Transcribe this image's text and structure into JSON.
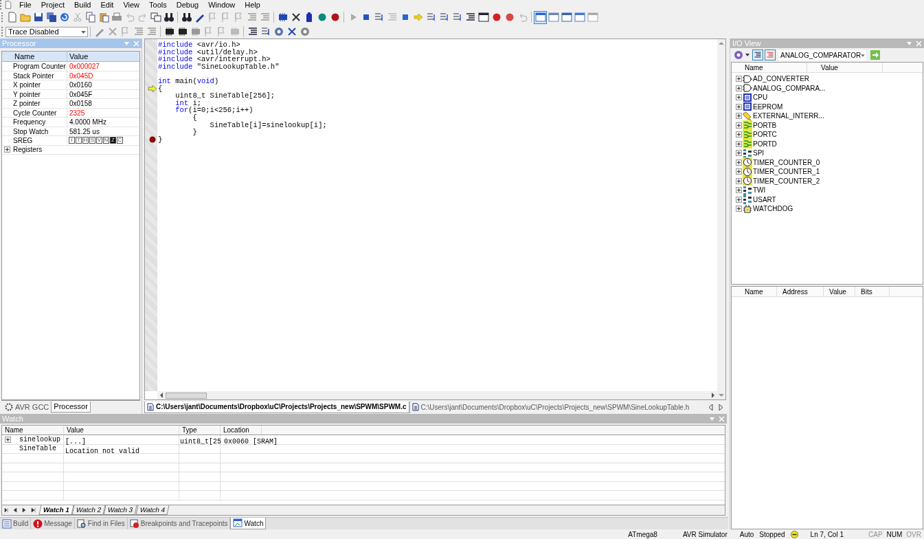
{
  "menu": [
    "File",
    "Project",
    "Build",
    "Edit",
    "View",
    "Tools",
    "Debug",
    "Window",
    "Help"
  ],
  "toolbar": {
    "trace_combo": "Trace Disabled"
  },
  "processor_panel": {
    "title": "Processor",
    "columns": [
      "Name",
      "Value"
    ],
    "rows": [
      {
        "name": "Program Counter",
        "value": "0x000027",
        "changed": true
      },
      {
        "name": "Stack Pointer",
        "value": "0x045D",
        "changed": true
      },
      {
        "name": "X pointer",
        "value": "0x0160",
        "changed": false
      },
      {
        "name": "Y pointer",
        "value": "0x045F",
        "changed": false
      },
      {
        "name": "Z pointer",
        "value": "0x0158",
        "changed": false
      },
      {
        "name": "Cycle Counter",
        "value": "2325",
        "changed": true
      },
      {
        "name": "Frequency",
        "value": "4.0000 MHz",
        "changed": false
      },
      {
        "name": "Stop Watch",
        "value": "581.25 us",
        "changed": false
      }
    ],
    "sreg": {
      "name": "SREG",
      "flags": [
        {
          "label": "I",
          "set": false
        },
        {
          "label": "T",
          "set": false
        },
        {
          "label": "H",
          "set": false
        },
        {
          "label": "S",
          "set": false
        },
        {
          "label": "V",
          "set": false
        },
        {
          "label": "N",
          "set": false
        },
        {
          "label": "Z",
          "set": true
        },
        {
          "label": "C",
          "set": false
        }
      ]
    },
    "registers": {
      "name": "Registers",
      "expanded": false
    },
    "tabs": [
      {
        "label": "AVR GCC",
        "selected": false
      },
      {
        "label": "Processor",
        "selected": true
      }
    ]
  },
  "editor": {
    "blocks": [
      {
        "lines": [
          {
            "current": false,
            "breakpoint": false,
            "tokens": [
              {
                "kind": "keyword",
                "text": "#include"
              },
              {
                "kind": "plain",
                "text": " <avr/io.h>"
              }
            ]
          },
          {
            "current": false,
            "breakpoint": false,
            "tokens": [
              {
                "kind": "keyword",
                "text": "#include"
              },
              {
                "kind": "plain",
                "text": " <util/delay.h>"
              }
            ]
          },
          {
            "current": false,
            "breakpoint": false,
            "tokens": [
              {
                "kind": "keyword",
                "text": "#include"
              },
              {
                "kind": "plain",
                "text": " <avr/interrupt.h>"
              }
            ]
          },
          {
            "current": false,
            "breakpoint": false,
            "tokens": [
              {
                "kind": "keyword",
                "text": "#include"
              },
              {
                "kind": "plain",
                "text": " \"SineLookupTable.h\""
              }
            ]
          }
        ]
      },
      {
        "lines": [
          {
            "current": false,
            "breakpoint": false,
            "tokens": [
              {
                "kind": "keyword",
                "text": "int"
              },
              {
                "kind": "plain",
                "text": " main("
              },
              {
                "kind": "keyword",
                "text": "void"
              },
              {
                "kind": "plain",
                "text": ")"
              }
            ]
          },
          {
            "current": true,
            "breakpoint": false,
            "tokens": [
              {
                "kind": "plain",
                "text": "{"
              }
            ]
          },
          {
            "current": false,
            "breakpoint": false,
            "tokens": [
              {
                "kind": "plain",
                "text": "    uint8_t SineTable[256];"
              }
            ]
          },
          {
            "current": false,
            "breakpoint": false,
            "tokens": [
              {
                "kind": "keyword",
                "text": "    int"
              },
              {
                "kind": "plain",
                "text": " i;"
              }
            ]
          },
          {
            "current": false,
            "breakpoint": false,
            "tokens": [
              {
                "kind": "keyword",
                "text": "    for"
              },
              {
                "kind": "plain",
                "text": "(i=0;i<256;i++)"
              }
            ]
          },
          {
            "current": false,
            "breakpoint": false,
            "tokens": [
              {
                "kind": "plain",
                "text": "        {"
              }
            ]
          },
          {
            "current": false,
            "breakpoint": false,
            "tokens": [
              {
                "kind": "plain",
                "text": "            SineTable[i]=sinelookup[i];"
              }
            ]
          },
          {
            "current": false,
            "breakpoint": false,
            "tokens": [
              {
                "kind": "plain",
                "text": "        }"
              }
            ]
          },
          {
            "current": false,
            "breakpoint": true,
            "tokens": [
              {
                "kind": "plain",
                "text": "}"
              }
            ]
          }
        ]
      }
    ],
    "tabs": [
      {
        "label": "C:\\Users\\jant\\Documents\\Dropbox\\uC\\Projects\\Projects_new\\SPWM\\SPWM.c",
        "selected": true
      },
      {
        "label": "C:\\Users\\jant\\Documents\\Dropbox\\uC\\Projects\\Projects_new\\SPWM\\SineLookupTable.h",
        "selected": false
      }
    ]
  },
  "io_view": {
    "title": "I/O View",
    "combo": "ANALOG_COMPARATOR",
    "columns": [
      "Name",
      "Value"
    ],
    "items": [
      {
        "name": "AD_CONVERTER",
        "kind": "adc",
        "expanded": false
      },
      {
        "name": "ANALOG_COMPARA...",
        "kind": "adc",
        "expanded": false
      },
      {
        "name": "CPU",
        "kind": "register",
        "expanded": false
      },
      {
        "name": "EEPROM",
        "kind": "register",
        "expanded": false
      },
      {
        "name": "EXTERNAL_INTERR...",
        "kind": "interrupt",
        "expanded": false
      },
      {
        "name": "PORTB",
        "kind": "port",
        "expanded": false
      },
      {
        "name": "PORTC",
        "kind": "port",
        "expanded": false
      },
      {
        "name": "PORTD",
        "kind": "port",
        "expanded": false
      },
      {
        "name": "SPI",
        "kind": "serial",
        "expanded": false
      },
      {
        "name": "TIMER_COUNTER_0",
        "kind": "timer",
        "expanded": false
      },
      {
        "name": "TIMER_COUNTER_1",
        "kind": "timer",
        "expanded": false
      },
      {
        "name": "TIMER_COUNTER_2",
        "kind": "timer",
        "expanded": false
      },
      {
        "name": "TWI",
        "kind": "serial",
        "expanded": false
      },
      {
        "name": "USART",
        "kind": "serial",
        "expanded": false
      },
      {
        "name": "WATCHDOG",
        "kind": "watchdog",
        "expanded": false
      }
    ],
    "detail_columns": [
      "Name",
      "Address",
      "Value",
      "Bits"
    ]
  },
  "watch": {
    "title": "Watch",
    "columns": [
      "Name",
      "Value",
      "Type",
      "Location"
    ],
    "rows": [
      {
        "name": "sinelookup",
        "value": "[...]",
        "type": "uint8_t[25",
        "location": "0x0060 [SRAM]",
        "expandable": true,
        "expanded": false
      },
      {
        "name": "SineTable",
        "value": "Location not valid",
        "expandable": false
      }
    ],
    "tabs": [
      {
        "label": "Watch 1",
        "selected": true
      },
      {
        "label": "Watch 2",
        "selected": false
      },
      {
        "label": "Watch 3",
        "selected": false
      },
      {
        "label": "Watch 4",
        "selected": false
      }
    ]
  },
  "bottom_tabs": [
    {
      "label": "Build",
      "kind": "build",
      "selected": false
    },
    {
      "label": "Message",
      "kind": "message",
      "selected": false
    },
    {
      "label": "Find in Files",
      "kind": "find",
      "selected": false
    },
    {
      "label": "Breakpoints and Tracepoints",
      "kind": "breakpoints",
      "selected": false
    },
    {
      "label": "Watch",
      "kind": "watch",
      "selected": true
    }
  ],
  "status_bar": {
    "device": "ATmega8",
    "platform": "AVR Simulator",
    "mode": "Auto",
    "state": "Stopped",
    "position": "Ln 7, Col 1",
    "keys": [
      {
        "label": "CAP",
        "on": false
      },
      {
        "label": "NUM",
        "on": true
      },
      {
        "label": "OVR",
        "on": false
      }
    ]
  }
}
